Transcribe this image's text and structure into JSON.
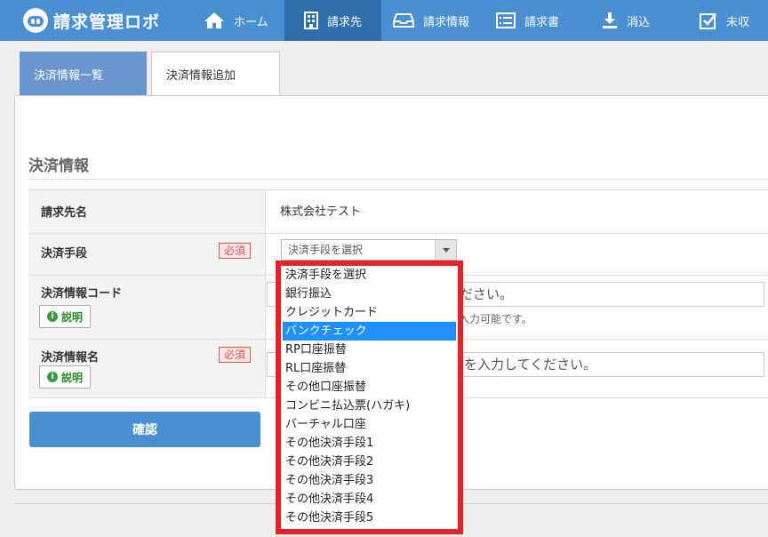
{
  "app": {
    "title": "請求管理ロボ"
  },
  "nav": [
    {
      "label": "ホーム",
      "icon": "home-icon",
      "active": false
    },
    {
      "label": "請求先",
      "icon": "building-icon",
      "active": true
    },
    {
      "label": "請求情報",
      "icon": "inbox-icon",
      "active": false
    },
    {
      "label": "請求書",
      "icon": "list-icon",
      "active": false
    },
    {
      "label": "消込",
      "icon": "download-icon",
      "active": false
    },
    {
      "label": "未収",
      "icon": "checkbox-icon",
      "active": false
    }
  ],
  "tabs": [
    {
      "label": "決済情報一覧"
    },
    {
      "label": "決済情報追加"
    }
  ],
  "section": {
    "title": "決済情報"
  },
  "form": {
    "customer_name": {
      "label": "請求先名",
      "value": "株式会社テスト"
    },
    "payment_method": {
      "label": "決済手段",
      "required": "必須",
      "selected": "決済手段を選択"
    },
    "payment_code": {
      "label": "決済情報コード",
      "help": "説明",
      "placeholder_tail": "ださい。",
      "hint_tail": "入力可能です。"
    },
    "payment_name": {
      "label": "決済情報名",
      "required": "必須",
      "help": "説明",
      "placeholder_tail": "前を入力してください。"
    },
    "confirm_label": "確認"
  },
  "dropdown": {
    "options": [
      "決済手段を選択",
      "銀行振込",
      "クレジットカード",
      "バンクチェック",
      "RP口座振替",
      "RL口座振替",
      "その他口座振替",
      "コンビニ払込票(ハガキ)",
      "バーチャル口座",
      "その他決済手段1",
      "その他決済手段2",
      "その他決済手段3",
      "その他決済手段4",
      "その他決済手段5"
    ],
    "highlighted": "バンクチェック"
  },
  "colors": {
    "nav": "#4a8fcf",
    "nav_active": "#2f6ea8",
    "highlight": "#e5212b",
    "selected_option": "#1e90ff"
  }
}
